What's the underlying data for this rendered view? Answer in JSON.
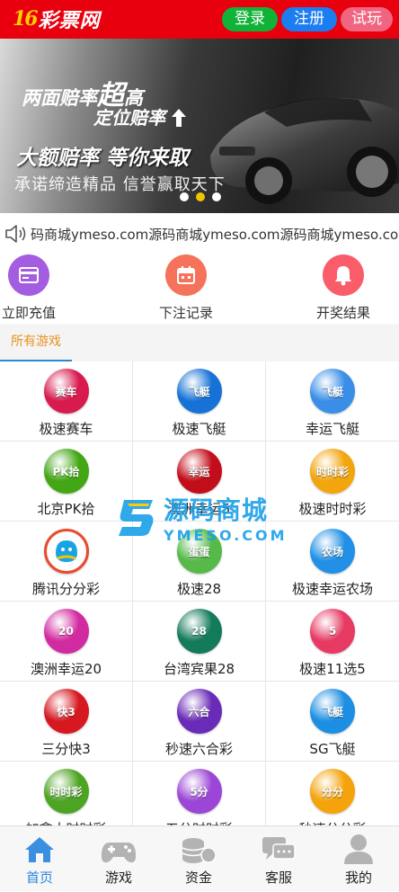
{
  "header": {
    "logo_mark": "16",
    "logo_text": "彩票网",
    "login_label": "登录",
    "register_label": "注册",
    "trial_label": "试玩",
    "colors": {
      "background": "#e8000f",
      "login": "#11b238",
      "register": "#1a7df0",
      "trial": "#f06680"
    }
  },
  "banner": {
    "line1_part1": "两面赔率",
    "line1_big": "超",
    "line1_part2": "高",
    "line2": "定位赔率",
    "line3": "大额赔率 等你来取",
    "line4": "承诺缔造精品 信誉赢取天下",
    "dots_total": 3,
    "dots_active_index": 1
  },
  "notice": {
    "icon": "speaker-icon",
    "text": "码商城ymeso.com源码商城ymeso.com源码商城ymeso.com"
  },
  "quick_actions": [
    {
      "label": "立即充值",
      "icon": "card-icon",
      "color": "#a45de0"
    },
    {
      "label": "下注记录",
      "icon": "calendar-icon",
      "color": "#f4735a"
    },
    {
      "label": "开奖结果",
      "icon": "bell-icon",
      "color": "#f95d6a"
    }
  ],
  "section": {
    "tab_label": "所有游戏"
  },
  "games": [
    {
      "label": "极速赛车",
      "icon": "race-car-icon",
      "badge": "赛车",
      "color": "#d81b4f"
    },
    {
      "label": "极速飞艇",
      "icon": "speedboat-icon",
      "badge": "飞艇",
      "color": "#1672d6"
    },
    {
      "label": "幸运飞艇",
      "icon": "lucky-boat-icon",
      "badge": "飞艇",
      "color": "#3a8ee8"
    },
    {
      "label": "北京PK拾",
      "icon": "pk10-icon",
      "badge": "PK拾",
      "color": "#43a614"
    },
    {
      "label": "澳洲幸运5",
      "icon": "lucky5-icon",
      "badge": "幸运",
      "color": "#c20e1a"
    },
    {
      "label": "极速时时彩",
      "icon": "ssc-icon",
      "badge": "时时彩",
      "color": "#f2a50c"
    },
    {
      "label": "腾讯分分彩",
      "icon": "tencent-icon",
      "badge": "",
      "color": "#ffffff"
    },
    {
      "label": "极速28",
      "icon": "egg-icon",
      "badge": "蛋蛋",
      "color": "#56b94a"
    },
    {
      "label": "极速幸运农场",
      "icon": "farm-icon",
      "badge": "农场",
      "color": "#2190e6"
    },
    {
      "label": "澳洲幸运20",
      "icon": "lucky20-icon",
      "badge": "20",
      "color": "#d22aa0"
    },
    {
      "label": "台湾宾果28",
      "icon": "bingo28-icon",
      "badge": "28",
      "color": "#137a5c"
    },
    {
      "label": "极速11选5",
      "icon": "pick11-icon",
      "badge": "5",
      "color": "#e63a63"
    },
    {
      "label": "三分快3",
      "icon": "dice-icon",
      "badge": "快3",
      "color": "#d61820"
    },
    {
      "label": "秒速六合彩",
      "icon": "marksix-icon",
      "badge": "六合",
      "color": "#6a2bb8"
    },
    {
      "label": "SG飞艇",
      "icon": "sg-boat-icon",
      "badge": "飞艇",
      "color": "#1d8fe3"
    },
    {
      "label": "加拿大时时彩",
      "icon": "canada-icon",
      "badge": "时时彩",
      "color": "#4da423"
    },
    {
      "label": "五分时时彩",
      "icon": "ssc5-icon",
      "badge": "5分",
      "color": "#9b46d6"
    },
    {
      "label": "秒速分分彩",
      "icon": "ffc-icon",
      "badge": "分分",
      "color": "#f4a30a"
    }
  ],
  "watermark": {
    "text": "源码商城",
    "sub": "YMESO.COM"
  },
  "tabbar": [
    {
      "label": "首页",
      "icon": "home-icon",
      "active": true
    },
    {
      "label": "游戏",
      "icon": "gamepad-icon",
      "active": false
    },
    {
      "label": "资金",
      "icon": "coins-icon",
      "active": false
    },
    {
      "label": "客服",
      "icon": "chat-icon",
      "active": false
    },
    {
      "label": "我的",
      "icon": "user-icon",
      "active": false
    }
  ]
}
